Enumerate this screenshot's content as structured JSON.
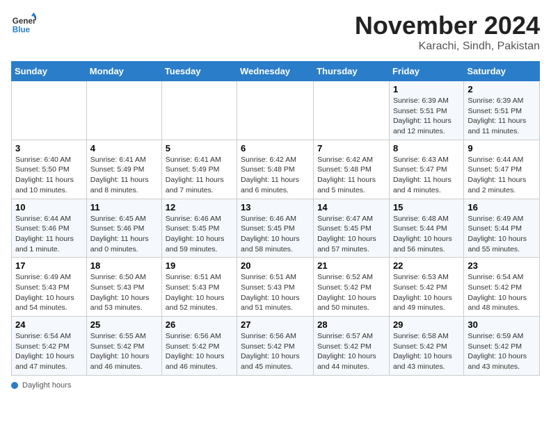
{
  "header": {
    "logo_line1": "General",
    "logo_line2": "Blue",
    "month": "November 2024",
    "location": "Karachi, Sindh, Pakistan"
  },
  "days_of_week": [
    "Sunday",
    "Monday",
    "Tuesday",
    "Wednesday",
    "Thursday",
    "Friday",
    "Saturday"
  ],
  "legend": {
    "daylight_label": "Daylight hours"
  },
  "weeks": [
    [
      {
        "day": "",
        "info": ""
      },
      {
        "day": "",
        "info": ""
      },
      {
        "day": "",
        "info": ""
      },
      {
        "day": "",
        "info": ""
      },
      {
        "day": "",
        "info": ""
      },
      {
        "day": "1",
        "info": "Sunrise: 6:39 AM\nSunset: 5:51 PM\nDaylight: 11 hours and 12 minutes."
      },
      {
        "day": "2",
        "info": "Sunrise: 6:39 AM\nSunset: 5:51 PM\nDaylight: 11 hours and 11 minutes."
      }
    ],
    [
      {
        "day": "3",
        "info": "Sunrise: 6:40 AM\nSunset: 5:50 PM\nDaylight: 11 hours and 10 minutes."
      },
      {
        "day": "4",
        "info": "Sunrise: 6:41 AM\nSunset: 5:49 PM\nDaylight: 11 hours and 8 minutes."
      },
      {
        "day": "5",
        "info": "Sunrise: 6:41 AM\nSunset: 5:49 PM\nDaylight: 11 hours and 7 minutes."
      },
      {
        "day": "6",
        "info": "Sunrise: 6:42 AM\nSunset: 5:48 PM\nDaylight: 11 hours and 6 minutes."
      },
      {
        "day": "7",
        "info": "Sunrise: 6:42 AM\nSunset: 5:48 PM\nDaylight: 11 hours and 5 minutes."
      },
      {
        "day": "8",
        "info": "Sunrise: 6:43 AM\nSunset: 5:47 PM\nDaylight: 11 hours and 4 minutes."
      },
      {
        "day": "9",
        "info": "Sunrise: 6:44 AM\nSunset: 5:47 PM\nDaylight: 11 hours and 2 minutes."
      }
    ],
    [
      {
        "day": "10",
        "info": "Sunrise: 6:44 AM\nSunset: 5:46 PM\nDaylight: 11 hours and 1 minute."
      },
      {
        "day": "11",
        "info": "Sunrise: 6:45 AM\nSunset: 5:46 PM\nDaylight: 11 hours and 0 minutes."
      },
      {
        "day": "12",
        "info": "Sunrise: 6:46 AM\nSunset: 5:45 PM\nDaylight: 10 hours and 59 minutes."
      },
      {
        "day": "13",
        "info": "Sunrise: 6:46 AM\nSunset: 5:45 PM\nDaylight: 10 hours and 58 minutes."
      },
      {
        "day": "14",
        "info": "Sunrise: 6:47 AM\nSunset: 5:45 PM\nDaylight: 10 hours and 57 minutes."
      },
      {
        "day": "15",
        "info": "Sunrise: 6:48 AM\nSunset: 5:44 PM\nDaylight: 10 hours and 56 minutes."
      },
      {
        "day": "16",
        "info": "Sunrise: 6:49 AM\nSunset: 5:44 PM\nDaylight: 10 hours and 55 minutes."
      }
    ],
    [
      {
        "day": "17",
        "info": "Sunrise: 6:49 AM\nSunset: 5:43 PM\nDaylight: 10 hours and 54 minutes."
      },
      {
        "day": "18",
        "info": "Sunrise: 6:50 AM\nSunset: 5:43 PM\nDaylight: 10 hours and 53 minutes."
      },
      {
        "day": "19",
        "info": "Sunrise: 6:51 AM\nSunset: 5:43 PM\nDaylight: 10 hours and 52 minutes."
      },
      {
        "day": "20",
        "info": "Sunrise: 6:51 AM\nSunset: 5:43 PM\nDaylight: 10 hours and 51 minutes."
      },
      {
        "day": "21",
        "info": "Sunrise: 6:52 AM\nSunset: 5:42 PM\nDaylight: 10 hours and 50 minutes."
      },
      {
        "day": "22",
        "info": "Sunrise: 6:53 AM\nSunset: 5:42 PM\nDaylight: 10 hours and 49 minutes."
      },
      {
        "day": "23",
        "info": "Sunrise: 6:54 AM\nSunset: 5:42 PM\nDaylight: 10 hours and 48 minutes."
      }
    ],
    [
      {
        "day": "24",
        "info": "Sunrise: 6:54 AM\nSunset: 5:42 PM\nDaylight: 10 hours and 47 minutes."
      },
      {
        "day": "25",
        "info": "Sunrise: 6:55 AM\nSunset: 5:42 PM\nDaylight: 10 hours and 46 minutes."
      },
      {
        "day": "26",
        "info": "Sunrise: 6:56 AM\nSunset: 5:42 PM\nDaylight: 10 hours and 46 minutes."
      },
      {
        "day": "27",
        "info": "Sunrise: 6:56 AM\nSunset: 5:42 PM\nDaylight: 10 hours and 45 minutes."
      },
      {
        "day": "28",
        "info": "Sunrise: 6:57 AM\nSunset: 5:42 PM\nDaylight: 10 hours and 44 minutes."
      },
      {
        "day": "29",
        "info": "Sunrise: 6:58 AM\nSunset: 5:42 PM\nDaylight: 10 hours and 43 minutes."
      },
      {
        "day": "30",
        "info": "Sunrise: 6:59 AM\nSunset: 5:42 PM\nDaylight: 10 hours and 43 minutes."
      }
    ]
  ]
}
